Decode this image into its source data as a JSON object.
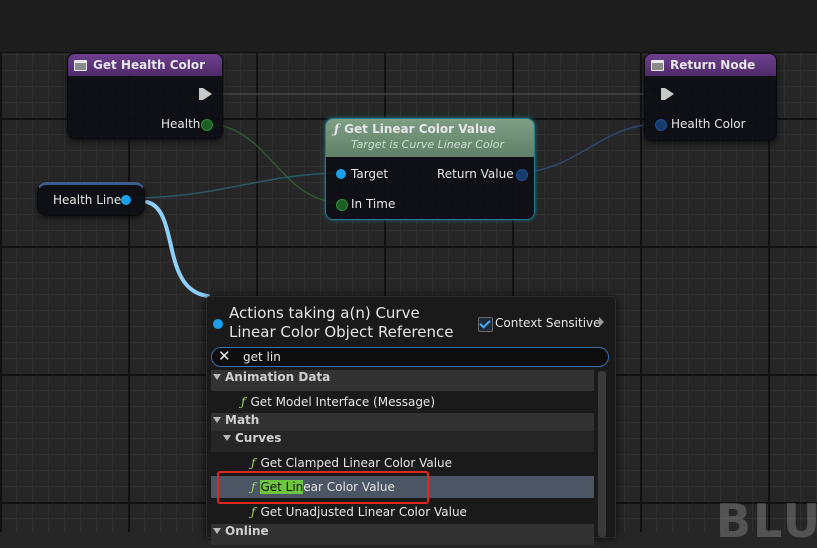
{
  "nodes": {
    "get_health_color": {
      "title": "Get Health Color",
      "output_pin": "Health"
    },
    "return_node": {
      "title": "Return Node",
      "input_pin": "Health Color"
    },
    "get_linear_color_value": {
      "title": "Get Linear Color Value",
      "subtitle": "Target is Curve Linear Color",
      "input_target": "Target",
      "input_time": "In Time",
      "output": "Return Value"
    },
    "health_line": {
      "label": "Health Line"
    }
  },
  "action_menu": {
    "title": "Actions taking a(n) Curve Linear Color Object Reference",
    "context_sensitive_label": "Context Sensitive",
    "context_sensitive_checked": true,
    "search_value": "get lin",
    "categories": [
      {
        "label": "Animation Data",
        "items": [
          "Get Model Interface (Message)"
        ]
      },
      {
        "label": "Math",
        "subcategory": "Curves",
        "items": [
          "Get Clamped Linear Color Value",
          "Get Linear Color Value",
          "Get Unadjusted Linear Color Value"
        ]
      },
      {
        "label": "Online"
      }
    ],
    "selected_item": {
      "highlight": "Get Lin",
      "rest": "ear Color Value"
    }
  },
  "watermark": "BLU",
  "colors": {
    "selection_box": "#e0261e",
    "wire_object": "#8fcff7",
    "header_purple": "#5b3477",
    "header_function": "#6f8f77"
  }
}
